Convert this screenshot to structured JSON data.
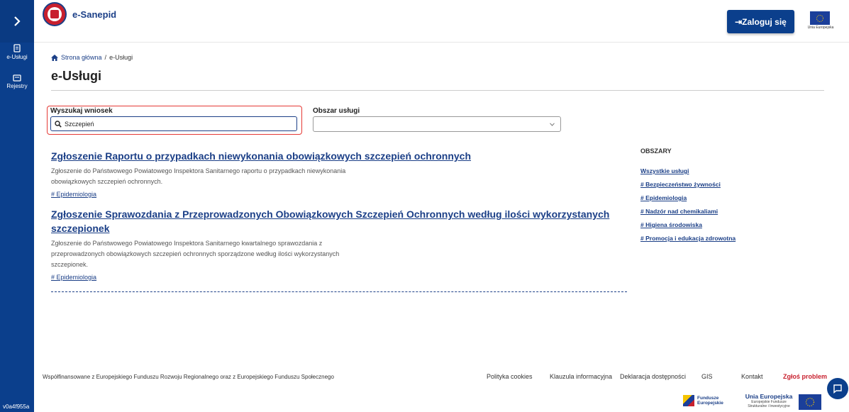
{
  "sidebar": {
    "toggle_icon": "chevron-right-icon",
    "items": [
      {
        "label": "e-Usługi",
        "icon": "document-icon"
      },
      {
        "label": "Rejestry",
        "icon": "folder-icon"
      }
    ],
    "version": "v0a4f955a"
  },
  "header": {
    "brand": "e-Sanepid",
    "login_label": "⇥Zaloguj się",
    "eu_label": "Unia Europejska"
  },
  "breadcrumb": {
    "home": "Strona główna",
    "separator": "/",
    "current": "e-Usługi"
  },
  "page": {
    "title": "e-Usługi"
  },
  "search": {
    "label": "Wyszukaj wniosek",
    "value": "Szczepień"
  },
  "area_filter": {
    "label": "Obszar usługi",
    "selected": ""
  },
  "results": [
    {
      "title": "Zgłoszenie Raportu o przypadkach niewykonania obowiązkowych szczepień ochronnych",
      "description": "Zgłoszenie do Państwowego Powiatowego Inspektora Sanitarnego raportu o przypadkach niewykonania obowiązkowych szczepień ochronnych.",
      "tag": "# Epidemiologia"
    },
    {
      "title": "Zgłoszenie Sprawozdania z Przeprowadzonych Obowiązkowych Szczepień Ochronnych według ilości wykorzystanych szczepionek",
      "description": "Zgłoszenie do Państwowego Powiatowego Inspektora Sanitarnego kwartalnego sprawozdania z przeprowadzonych obowiązkowych szczepień ochronnych sporządzone według ilości wykorzystanych szczepionek.",
      "tag": "# Epidemiologia"
    }
  ],
  "areas": {
    "heading": "OBSZARY",
    "links": [
      "Wszystkie usługi",
      "# Bezpieczeństwo żywności",
      "# Epidemiologia",
      "# Nadzór nad chemikaliami",
      "# Higiena środowiska",
      "# Promocja i edukacja zdrowotna"
    ]
  },
  "footer": {
    "cofinanced": "Współfinansowane z Europejskiego Funduszu Rozwoju Regionalnego oraz z Europejskiego Funduszu Społecznego",
    "links": [
      "Polityka cookies",
      "Klauzula informacyjna",
      "Deklaracja dostępności",
      "GIS",
      "Kontakt",
      "Zgłoś problem"
    ],
    "fe_line1": "Fundusze",
    "fe_line2": "Europejskie",
    "ue_title": "Unia Europejska",
    "ue_sub1": "Europejskie Fundusze",
    "ue_sub2": "Strukturalne i Inwestycyjne"
  },
  "colors": {
    "primary": "#0b3f8c",
    "link": "#1b3f87",
    "highlight_border": "#e53935",
    "report_problem": "#c8202e"
  }
}
